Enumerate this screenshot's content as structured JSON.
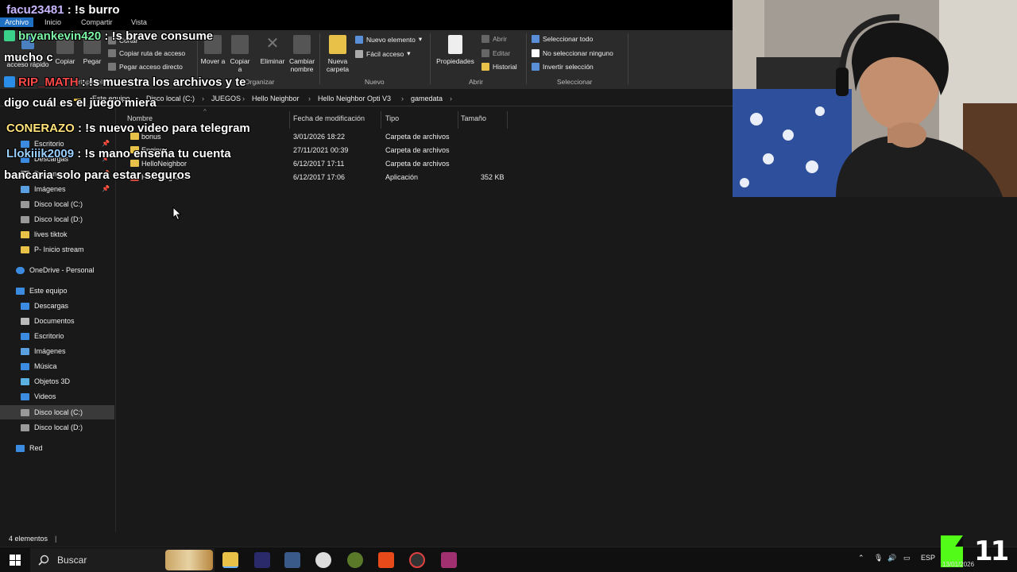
{
  "ribbon": {
    "tabs": [
      "Archivo",
      "Inicio",
      "Compartir",
      "Vista"
    ],
    "clipboard": {
      "pin_label": "Anclar al acceso rápido",
      "copy": "Copiar",
      "paste": "Pegar",
      "cut": "Cortar",
      "copy_path": "Copiar ruta de acceso",
      "paste_shortcut": "Pegar acceso directo",
      "group": "Portapapeles"
    },
    "organize": {
      "move": "Mover a",
      "copy_to": "Copiar a",
      "delete": "Eliminar",
      "rename": "Cambiar nombre",
      "group": "Organizar"
    },
    "new": {
      "new_folder": "Nueva carpeta",
      "new_item": "Nuevo elemento",
      "easy_access": "Fácil acceso",
      "group": "Nuevo"
    },
    "open": {
      "properties": "Propiedades",
      "open": "Abrir",
      "edit": "Editar",
      "history": "Historial",
      "group": "Abrir"
    },
    "select": {
      "select_all": "Seleccionar todo",
      "select_none": "No seleccionar ninguno",
      "invert": "Invertir selección",
      "group": "Seleccionar"
    }
  },
  "address": {
    "crumbs": [
      "Este equipo",
      "Disco local (C:)",
      "JUEGOS",
      "Hello Neighbor",
      "Hello Neighbor Opti V3",
      "gamedata"
    ]
  },
  "nav": {
    "quick": [
      {
        "label": "Escritorio",
        "pinned": true
      },
      {
        "label": "Descargas",
        "pinned": true
      },
      {
        "label": "Documentos",
        "pinned": true
      },
      {
        "label": "Imágenes",
        "pinned": true
      },
      {
        "label": "Disco local (C:)",
        "pinned": false
      },
      {
        "label": "Disco local (D:)",
        "pinned": false
      },
      {
        "label": "lives tiktok",
        "pinned": false
      },
      {
        "label": "P- Inicio stream",
        "pinned": false
      }
    ],
    "onedrive": "OneDrive - Personal",
    "this_pc": "Este equipo",
    "pc_items": [
      "Descargas",
      "Documentos",
      "Escritorio",
      "Imágenes",
      "Música",
      "Objetos 3D",
      "Videos",
      "Disco local (C:)",
      "Disco local (D:)"
    ],
    "network": "Red",
    "pin_glyph": "📌"
  },
  "files": {
    "headers": {
      "name": "Nombre",
      "date": "Fecha de modificación",
      "type": "Tipo",
      "size": "Tamaño"
    },
    "rows": [
      {
        "name": "bonus",
        "date": "3/01/2026 18:22",
        "type": "Carpeta de archivos",
        "size": "",
        "icon": "folder"
      },
      {
        "name": "Engine",
        "date": "27/11/2021 00:39",
        "type": "Carpeta de archivos",
        "size": "",
        "icon": "folder"
      },
      {
        "name": "HelloNeighbor",
        "date": "6/12/2017 17:11",
        "type": "Carpeta de archivos",
        "size": "",
        "icon": "folder"
      },
      {
        "name": "HelloNeighbor",
        "date": "6/12/2017 17:06",
        "type": "Aplicación",
        "size": "352 KB",
        "icon": "app"
      }
    ]
  },
  "status": {
    "count": "4 elementos"
  },
  "taskbar": {
    "search_placeholder": "Buscar",
    "lang": "ESP",
    "date": "13/01/2026"
  },
  "chat": [
    {
      "user": "facu23481",
      "user_color": "#c9b6ff",
      "text": ": !s burro"
    },
    {
      "user": "bryankevin420",
      "user_color": "#7df5a6",
      "text": ": !s brave consume"
    },
    {
      "user": "",
      "user_color": "#ffffff",
      "text": "mucho c"
    },
    {
      "user": "RIP_MATH",
      "user_color": "#ff4a4a",
      "text": ": !s muestra los archivos y te"
    },
    {
      "user": "",
      "user_color": "#ffffff",
      "text": "digo cuál es el juego miera"
    },
    {
      "user": "CONERAZO",
      "user_color": "#ffe27a",
      "text": ": !s nuevo video para telegram"
    },
    {
      "user": "Llokiiik2009",
      "user_color": "#9ad0ff",
      "text": ": !s mano enseña tu cuenta"
    },
    {
      "user": "",
      "user_color": "#ffffff",
      "text": "bancaria solo para estar seguros"
    }
  ],
  "overlay": {
    "viewer_count": "11"
  },
  "colors": {
    "accent": "#1f6fc2",
    "folder": "#e8c248",
    "kick_green": "#53fc18"
  }
}
